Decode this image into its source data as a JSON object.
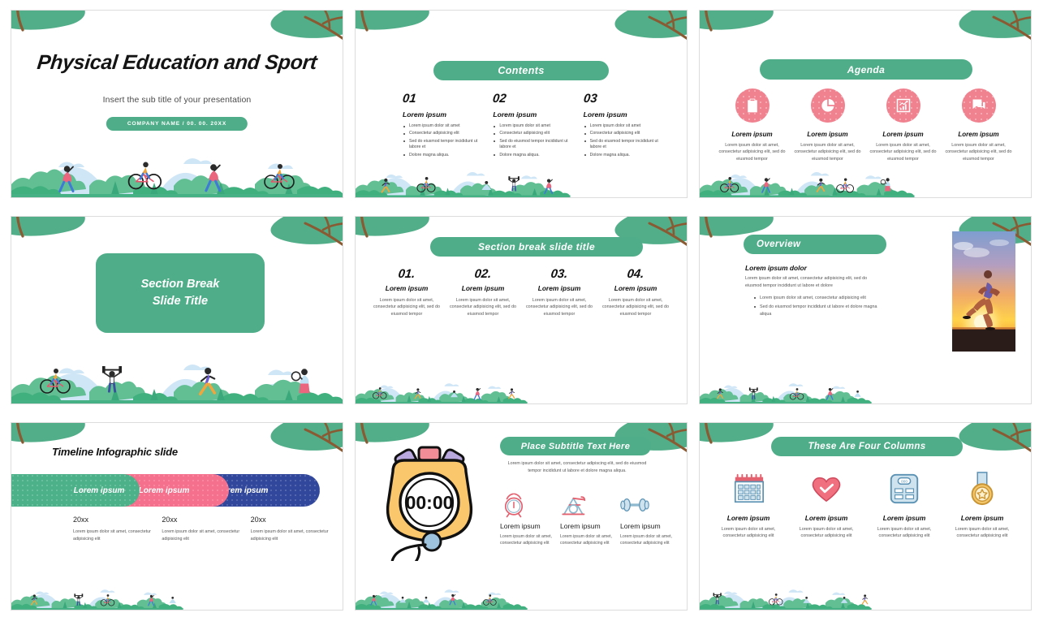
{
  "theme": {
    "green": "#4fae89",
    "pink": "#f0818f",
    "timeline_pink": "#f4708c",
    "timeline_blue": "#30479b",
    "branch_brown": "#8a5a33",
    "text_dark": "#111111",
    "text_body": "#555555"
  },
  "slides": [
    {
      "id": "title-slide",
      "title": "Physical Education and Sport",
      "subtitle": "Insert the sub title of your presentation",
      "badge": "COMPANY NAME  /  00. 00. 20XX"
    },
    {
      "id": "contents-slide",
      "heading": "Contents",
      "columns": [
        {
          "number": "01",
          "head": "Lorem ipsum",
          "bullets": [
            "Lorem ipsum dolor sit amet",
            "Consectetur adipisicing elit",
            "Sed do eiusmod tempor incididunt ut labore et",
            "Dolore magna aliqua."
          ]
        },
        {
          "number": "02",
          "head": "Lorem ipsum",
          "bullets": [
            "Lorem ipsum dolor sit amet",
            "Consectetur adipisicing elit",
            "Sed do eiusmod tempor incididunt ut labore et",
            "Dolore magna aliqua."
          ]
        },
        {
          "number": "03",
          "head": "Lorem ipsum",
          "bullets": [
            "Lorem ipsum dolor sit amet",
            "Consectetur adipisicing elit",
            "Sed do eiusmod tempor incididunt ut labore et",
            "Dolore magna aliqua."
          ]
        }
      ]
    },
    {
      "id": "agenda-slide",
      "heading": "Agenda",
      "columns": [
        {
          "icon": "clipboard-checklist-icon",
          "head": "Lorem ipsum",
          "body": "Lorem ipsum dolor sit amet, consectetur adipisicing elit, sed do eiusmod tempor"
        },
        {
          "icon": "pie-chart-icon",
          "head": "Lorem ipsum",
          "body": "Lorem ipsum dolor sit amet, consectetur adipisicing elit, sed do eiusmod tempor"
        },
        {
          "icon": "bar-chart-growth-icon",
          "head": "Lorem ipsum",
          "body": "Lorem ipsum dolor sit amet, consectetur adipisicing elit, sed do eiusmod tempor"
        },
        {
          "icon": "chat-bubbles-icon",
          "head": "Lorem ipsum",
          "body": "Lorem ipsum dolor sit amet, consectetur adipisicing elit, sed do eiusmod tempor"
        }
      ]
    },
    {
      "id": "section-break-slide",
      "line1": "Section Break",
      "line2": "Slide Title"
    },
    {
      "id": "section-break-columns-slide",
      "heading": "Section break slide title",
      "columns": [
        {
          "number": "01.",
          "head": "Lorem ipsum",
          "body": "Lorem ipsum dolor sit amet, consectetur adipisicing elit, sed do eiusmod tempor"
        },
        {
          "number": "02.",
          "head": "Lorem ipsum",
          "body": "Lorem ipsum dolor sit amet, consectetur adipisicing elit, sed do eiusmod tempor"
        },
        {
          "number": "03.",
          "head": "Lorem ipsum",
          "body": "Lorem ipsum dolor sit amet, consectetur adipisicing elit, sed do eiusmod tempor"
        },
        {
          "number": "04.",
          "head": "Lorem ipsum",
          "body": "Lorem ipsum dolor sit amet, consectetur adipisicing elit, sed do eiusmod tempor"
        }
      ]
    },
    {
      "id": "overview-slide",
      "heading": "Overview",
      "subhead": "Lorem ipsum dolor",
      "body": "Lorem ipsum dolor sit amet, consectetur adipisicing elit, sed do eiusmod tempor incididunt ut labore et dolore",
      "bullets": [
        "Lorem ipsum dolor sit amet, consectetur adipisicing elit",
        "Sed do eiusmod tempor incididunt ut labore et dolore magna aliqua"
      ],
      "photo_alt": "runner-at-sunset-photo"
    },
    {
      "id": "timeline-infographic-slide",
      "heading": "Timeline Infographic slide",
      "bars": [
        {
          "label": "Lorem ipsum",
          "color": "#4cb189"
        },
        {
          "label": "Lorem ipsum",
          "color": "#f4708c"
        },
        {
          "label": "Lorem ipsum",
          "color": "#30479b"
        }
      ],
      "cells": [
        {
          "year": "20xx",
          "body": "Lorem ipsum dolor sit amet, consectetur adipisicing elit"
        },
        {
          "year": "20xx",
          "body": "Lorem ipsum dolor sit amet, consectetur adipisicing elit"
        },
        {
          "year": "20xx",
          "body": "Lorem ipsum dolor sit amet, consectetur adipisicing elit"
        }
      ]
    },
    {
      "id": "stopwatch-slide",
      "heading": "Place Subtitle Text Here",
      "lead": "Lorem ipsum dolor sit amet, consectetur adipiscing elit, sed do eiusmod tempor incididunt ut labore et dolore magna aliqua.",
      "stopwatch_display": "00:00",
      "columns": [
        {
          "icon": "alarm-clock-icon",
          "head": "Lorem ipsum",
          "body": "Lorem ipsum dolor sit amet, consectetur adipisicing elit"
        },
        {
          "icon": "exercise-bike-icon",
          "head": "Lorem ipsum",
          "body": "Lorem ipsum dolor sit amet, consectetur adipisicing elit"
        },
        {
          "icon": "dumbbell-icon",
          "head": "Lorem ipsum",
          "body": "Lorem ipsum dolor sit amet, consectetur adipisicing elit"
        }
      ]
    },
    {
      "id": "four-columns-slide",
      "heading": "These Are Four Columns",
      "columns": [
        {
          "icon": "calendar-icon",
          "head": "Lorem ipsum",
          "body": "Lorem ipsum dolor sit amet, consectetur adipisicing elit"
        },
        {
          "icon": "heart-check-icon",
          "head": "Lorem ipsum",
          "body": "Lorem ipsum dolor sit amet, consectetur adipisicing elit"
        },
        {
          "icon": "weight-scale-icon",
          "head": "Lorem ipsum",
          "body": "Lorem ipsum dolor sit amet, consectetur adipisicing elit"
        },
        {
          "icon": "medal-icon",
          "head": "Lorem ipsum",
          "body": "Lorem ipsum dolor sit amet, consectetur adipisicing elit"
        }
      ]
    }
  ]
}
